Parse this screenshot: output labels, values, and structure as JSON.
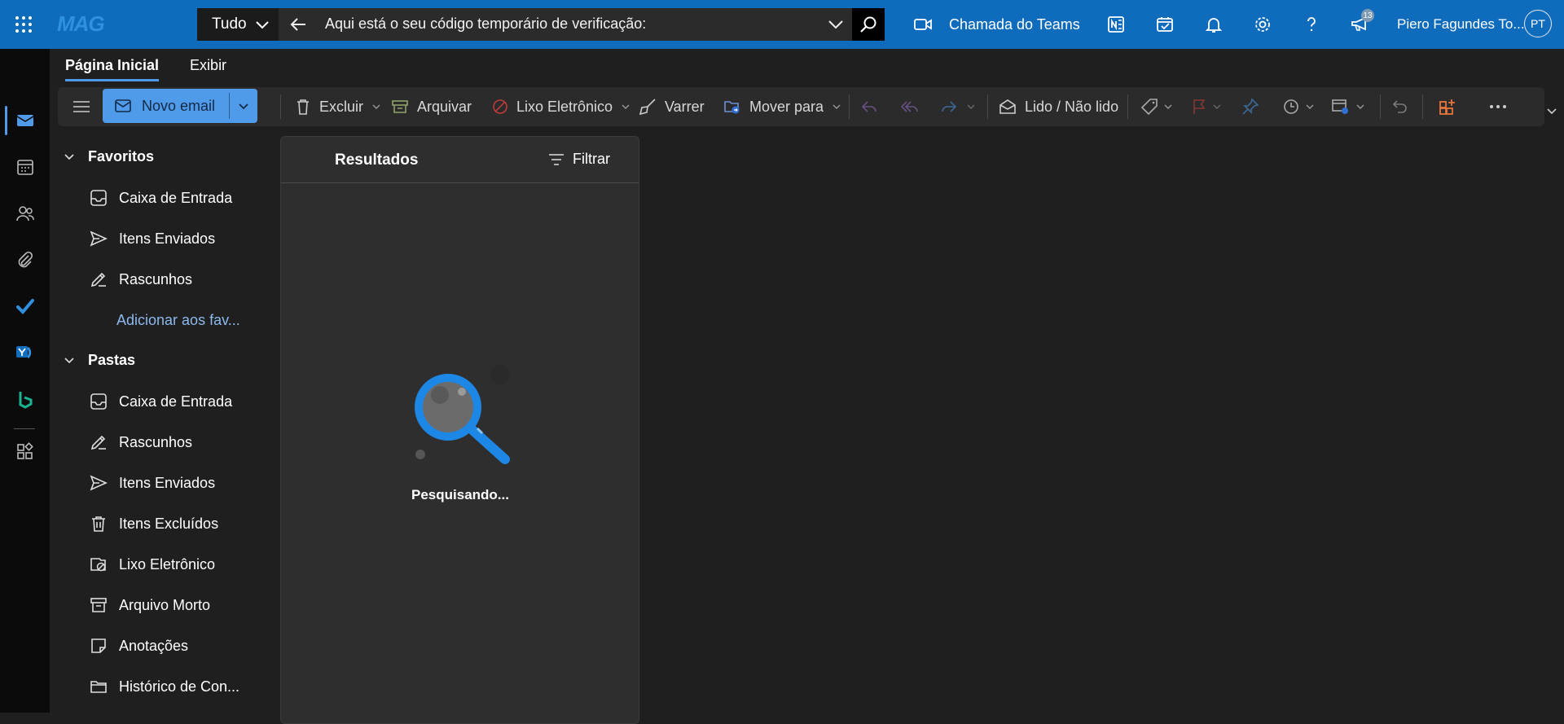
{
  "topbar": {
    "brand": "MAG",
    "search_scope": "Tudo",
    "search_query": "Aqui está o seu código temporário de verificação:",
    "teams_call_label": "Chamada do Teams",
    "notification_badge": "13",
    "user_name": "Piero Fagundes To...",
    "user_initials": "PT"
  },
  "ribbon": {
    "tabs": [
      {
        "label": "Página Inicial"
      },
      {
        "label": "Exibir"
      }
    ],
    "new_email": "Novo email",
    "delete": "Excluir",
    "archive": "Arquivar",
    "junk": "Lixo Eletrônico",
    "sweep": "Varrer",
    "move_to": "Mover para",
    "read_unread": "Lido / Não lido"
  },
  "folders": {
    "favorites_header": "Favoritos",
    "favorites": [
      {
        "label": "Caixa de Entrada",
        "icon": "inbox-icon"
      },
      {
        "label": "Itens Enviados",
        "icon": "send-icon"
      },
      {
        "label": "Rascunhos",
        "icon": "draft-icon"
      }
    ],
    "add_favorite": "Adicionar aos fav...",
    "folders_header": "Pastas",
    "items": [
      {
        "label": "Caixa de Entrada",
        "icon": "inbox-icon"
      },
      {
        "label": "Rascunhos",
        "icon": "draft-icon"
      },
      {
        "label": "Itens Enviados",
        "icon": "send-icon"
      },
      {
        "label": "Itens Excluídos",
        "icon": "trash-icon"
      },
      {
        "label": "Lixo Eletrônico",
        "icon": "junk-icon"
      },
      {
        "label": "Arquivo Morto",
        "icon": "archive-icon"
      },
      {
        "label": "Anotações",
        "icon": "note-icon"
      },
      {
        "label": "Histórico de Con...",
        "icon": "folder-icon"
      }
    ]
  },
  "results": {
    "title": "Resultados",
    "filter_label": "Filtrar",
    "status": "Pesquisando..."
  },
  "colors": {
    "accent": "#0f6cbd",
    "button": "#4f9bea",
    "background": "#1f1f1f",
    "rail": "#0b0b0b"
  }
}
